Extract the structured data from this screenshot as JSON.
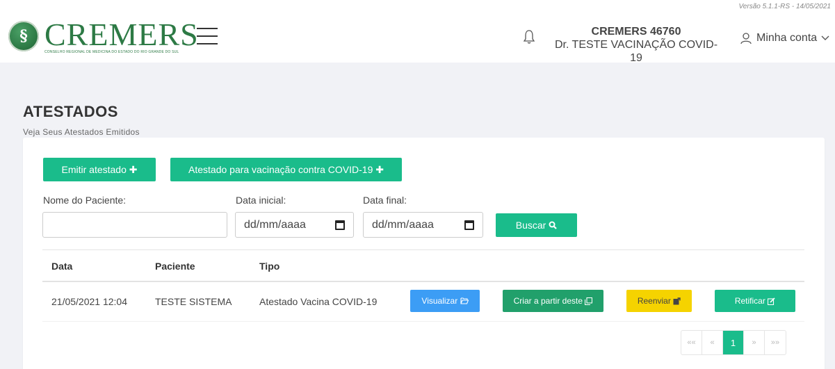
{
  "header": {
    "version": "Versão 5.1.1-RS - 14/05/2021",
    "logo": {
      "emblem": "§",
      "word": "CREMERS",
      "sub": "CONSELHO REGIONAL DE MEDICINA DO ESTADO DO RIO GRANDE DO SUL"
    },
    "user": {
      "crm": "CREMERS 46760",
      "name": "Dr. TESTE VACINAÇÃO COVID-19"
    },
    "account_label": "Minha conta",
    "icons": [
      "menu-icon",
      "bell-icon",
      "user-icon",
      "chevron-down-icon"
    ]
  },
  "page": {
    "title": "ATESTADOS",
    "subtitle": "Veja Seus Atestados Emitidos"
  },
  "actions": {
    "emitir": "Emitir atestado",
    "covid": "Atestado para vacinação contra COVID-19",
    "plus_glyph": "✚"
  },
  "filters": {
    "nome_label": "Nome do Paciente:",
    "nome_value": "",
    "data_inicial_label": "Data inicial:",
    "data_inicial_placeholder": "dd/mm/aaaa",
    "data_final_label": "Data final:",
    "data_final_placeholder": "dd/mm/aaaa",
    "buscar": "Buscar"
  },
  "table": {
    "columns": [
      "Data",
      "Paciente",
      "Tipo"
    ],
    "rows": [
      {
        "data": "21/05/2021 12:04",
        "paciente": "TESTE SISTEMA",
        "tipo": "Atestado Vacina COVID-19",
        "actions": {
          "visualizar": "Visualizar",
          "criar": "Criar a partir deste",
          "reenviar": "Reenviar",
          "retificar": "Retificar"
        }
      }
    ]
  },
  "pagination": {
    "first": "««",
    "prev": "«",
    "current": "1",
    "next": "»",
    "last": "»»"
  },
  "colors": {
    "green": "#1abc8b",
    "dark_green": "#21a06b",
    "blue": "#3c9df5",
    "yellow": "#f5d300",
    "brand": "#2d7a45"
  }
}
